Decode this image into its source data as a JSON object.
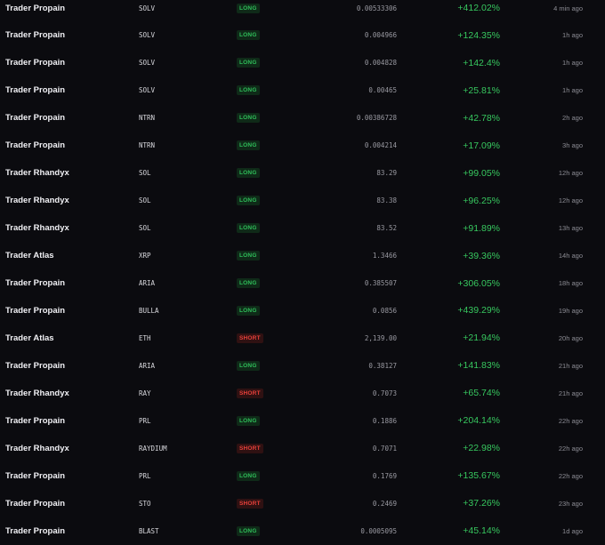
{
  "trades": [
    {
      "trader": "Trader Propain",
      "token": "SOLV",
      "side": "LONG",
      "price": "0.00533306",
      "pnl": "+412.02%",
      "time": "4 min ago"
    },
    {
      "trader": "Trader Propain",
      "token": "SOLV",
      "side": "LONG",
      "price": "0.004966",
      "pnl": "+124.35%",
      "time": "1h ago"
    },
    {
      "trader": "Trader Propain",
      "token": "SOLV",
      "side": "LONG",
      "price": "0.004828",
      "pnl": "+142.4%",
      "time": "1h ago"
    },
    {
      "trader": "Trader Propain",
      "token": "SOLV",
      "side": "LONG",
      "price": "0.00465",
      "pnl": "+25.81%",
      "time": "1h ago"
    },
    {
      "trader": "Trader Propain",
      "token": "NTRN",
      "side": "LONG",
      "price": "0.00386728",
      "pnl": "+42.78%",
      "time": "2h ago"
    },
    {
      "trader": "Trader Propain",
      "token": "NTRN",
      "side": "LONG",
      "price": "0.004214",
      "pnl": "+17.09%",
      "time": "3h ago"
    },
    {
      "trader": "Trader Rhandyx",
      "token": "SOL",
      "side": "LONG",
      "price": "83.29",
      "pnl": "+99.05%",
      "time": "12h ago"
    },
    {
      "trader": "Trader Rhandyx",
      "token": "SOL",
      "side": "LONG",
      "price": "83.38",
      "pnl": "+96.25%",
      "time": "12h ago"
    },
    {
      "trader": "Trader Rhandyx",
      "token": "SOL",
      "side": "LONG",
      "price": "83.52",
      "pnl": "+91.89%",
      "time": "13h ago"
    },
    {
      "trader": "Trader Atlas",
      "token": "XRP",
      "side": "LONG",
      "price": "1.3466",
      "pnl": "+39.36%",
      "time": "14h ago"
    },
    {
      "trader": "Trader Propain",
      "token": "ARIA",
      "side": "LONG",
      "price": "0.385507",
      "pnl": "+306.05%",
      "time": "18h ago"
    },
    {
      "trader": "Trader Propain",
      "token": "BULLA",
      "side": "LONG",
      "price": "0.0856",
      "pnl": "+439.29%",
      "time": "19h ago"
    },
    {
      "trader": "Trader Atlas",
      "token": "ETH",
      "side": "SHORT",
      "price": "2,139.00",
      "pnl": "+21.94%",
      "time": "20h ago"
    },
    {
      "trader": "Trader Propain",
      "token": "ARIA",
      "side": "LONG",
      "price": "0.38127",
      "pnl": "+141.83%",
      "time": "21h ago"
    },
    {
      "trader": "Trader Rhandyx",
      "token": "RAY",
      "side": "SHORT",
      "price": "0.7073",
      "pnl": "+65.74%",
      "time": "21h ago"
    },
    {
      "trader": "Trader Propain",
      "token": "PRL",
      "side": "LONG",
      "price": "0.1886",
      "pnl": "+204.14%",
      "time": "22h ago"
    },
    {
      "trader": "Trader Rhandyx",
      "token": "RAYDIUM",
      "side": "SHORT",
      "price": "0.7071",
      "pnl": "+22.98%",
      "time": "22h ago"
    },
    {
      "trader": "Trader Propain",
      "token": "PRL",
      "side": "LONG",
      "price": "0.1769",
      "pnl": "+135.67%",
      "time": "22h ago"
    },
    {
      "trader": "Trader Propain",
      "token": "STO",
      "side": "SHORT",
      "price": "0.2469",
      "pnl": "+37.26%",
      "time": "23h ago"
    },
    {
      "trader": "Trader Propain",
      "token": "BLAST",
      "side": "LONG",
      "price": "0.0005095",
      "pnl": "+45.14%",
      "time": "1d ago"
    }
  ],
  "colors": {
    "long": "#2fbf5a",
    "short": "#e8403a",
    "pnl": "#37c85f",
    "background": "#0b0b0f"
  }
}
